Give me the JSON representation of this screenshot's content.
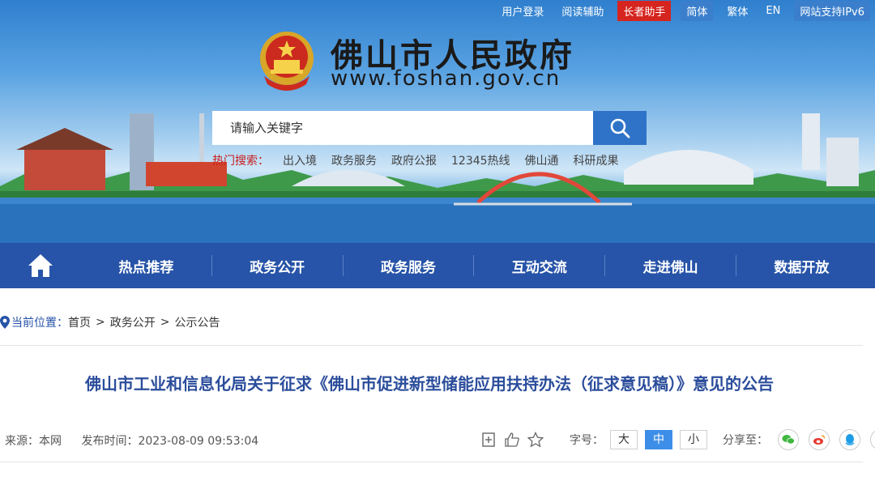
{
  "topbar": {
    "links": [
      "用户登录",
      "阅读辅助",
      "长者助手",
      "简体",
      "繁体",
      "EN",
      "网站支持IPv6"
    ]
  },
  "site": {
    "title": "佛山市人民政府",
    "url": "www.foshan.gov.cn"
  },
  "search": {
    "placeholder": "请输入关键字",
    "icon": "search-icon",
    "hot_label": "热门搜索：",
    "hot_items": [
      "出入境",
      "政务服务",
      "政府公报",
      "12345热线",
      "佛山通",
      "科研成果"
    ]
  },
  "nav": {
    "home_icon": "home-icon",
    "items": [
      "热点推荐",
      "政务公开",
      "政务服务",
      "互动交流",
      "走进佛山",
      "数据开放"
    ]
  },
  "breadcrumb": {
    "label": "当前位置：",
    "items": [
      "首页",
      "政务公开",
      "公示公告"
    ],
    "separator": ">"
  },
  "article": {
    "title": "佛山市工业和信息化局关于征求《佛山市促进新型储能应用扶持办法（征求意见稿）》意见的公告",
    "source": "来源：本网",
    "publish_time": "发布时间：2023-08-09 09:53:04"
  },
  "tools": {
    "font_size_label": "字号：",
    "font_sizes": [
      "大",
      "中",
      "小"
    ],
    "active_font_size": "中",
    "share_label": "分享至：",
    "share_icons": [
      "wechat-icon",
      "weibo-icon",
      "qq-icon",
      "qzone-icon"
    ]
  },
  "colors": {
    "nav_bg": "#2754a8",
    "title_blue": "#2b4d9b",
    "hot_red": "#c81e1e",
    "elder_red": "#d6241e",
    "active_blue": "#3d8ee8"
  }
}
